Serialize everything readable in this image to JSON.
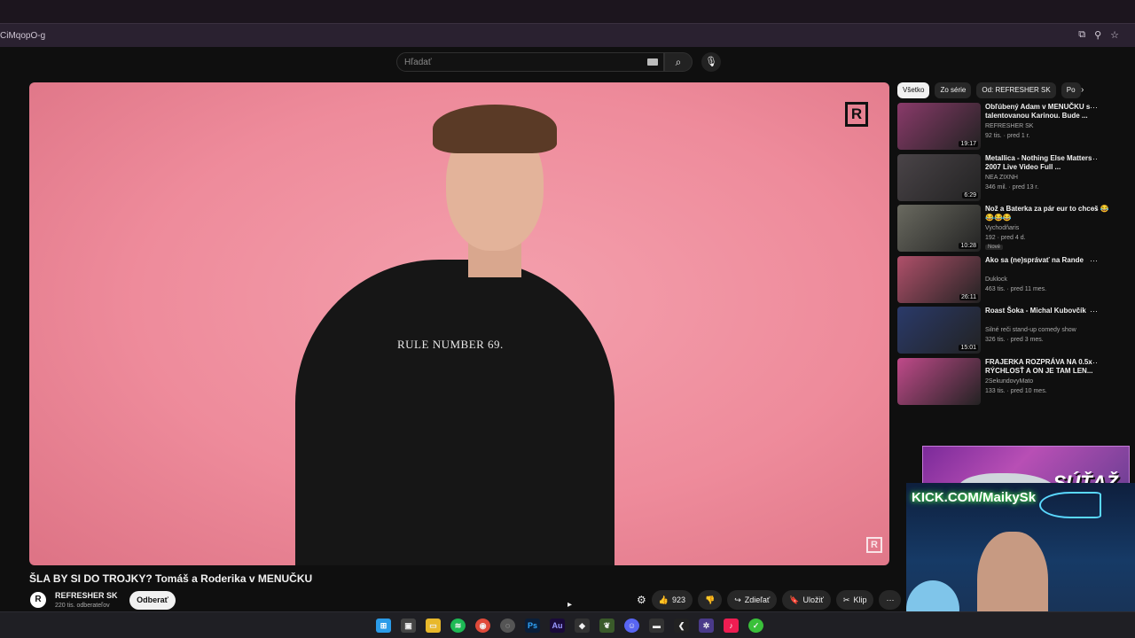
{
  "browser": {
    "url": "CiMqopO-g",
    "icons": [
      "screen-icon",
      "zoom-icon",
      "star-icon"
    ]
  },
  "search": {
    "placeholder": "Hľadať"
  },
  "video": {
    "shirt_text": "RULE NUMBER 69.",
    "title": "ŠLA BY SI DO TROJKY? Tomáš a Roderika v MENUČKU",
    "channel": "REFRESHER SK",
    "subscribers": "220 tis. odberateľov",
    "subscribe_label": "Odberať",
    "likes": "923",
    "share_label": "Zdieľať",
    "save_label": "Uložiť",
    "clip_label": "Klip"
  },
  "chips": [
    "Všetko",
    "Zo série",
    "Od: REFRESHER SK",
    "Po"
  ],
  "recommendations": [
    {
      "title": "Obľúbený Adam v MENUČKU s talentovanou Karinou. Bude ...",
      "channel": "REFRESHER SK",
      "meta": "92 tis. · pred 1 r.",
      "duration": "19:17",
      "color": "#8a3a6a"
    },
    {
      "title": "Metallica - Nothing Else Matters 2007 Live Video Full ...",
      "channel": "NEA ZIXNH",
      "meta": "346 mil. · pred 13 r.",
      "duration": "6:29",
      "color": "#4a4448"
    },
    {
      "title": "Nož a Baterka za pár eur to chceš 😂😂😂😂",
      "channel": "Vychodňaris",
      "meta": "192 · pred 4 d.",
      "duration": "10:28",
      "color": "#6a6a60",
      "badge": "Nové"
    },
    {
      "title": "Ako sa (ne)správať na Rande",
      "channel": "Duklock",
      "meta": "463 tis. · pred 11 mes.",
      "duration": "26:11",
      "color": "#b0506a"
    },
    {
      "title": "Roast Šoka - Michal Kubovčík",
      "channel": "Silné reči stand-up comedy show",
      "meta": "326 tis. · pred 3 mes.",
      "duration": "15:01",
      "color": "#2a3a6a"
    },
    {
      "title": "FRAJERKA ROZPRÁVA NA 0.5x RÝCHLOSŤ A ON JE TAM LEN...",
      "channel": "2SekundovyMato",
      "meta": "133 tis. · pred 10 mes.",
      "duration": "",
      "color": "#c04a8a"
    }
  ],
  "overlay": {
    "banner_text": "SÚŤAŽ",
    "kick_text": "KICK.COM/MaikySk"
  },
  "taskbar": [
    "windows",
    "task-view",
    "explorer",
    "spotify",
    "chrome",
    "app",
    "photoshop",
    "audition",
    "app2",
    "app3",
    "discord",
    "terminal",
    "capcut",
    "app4",
    "tiktok",
    "app5"
  ]
}
